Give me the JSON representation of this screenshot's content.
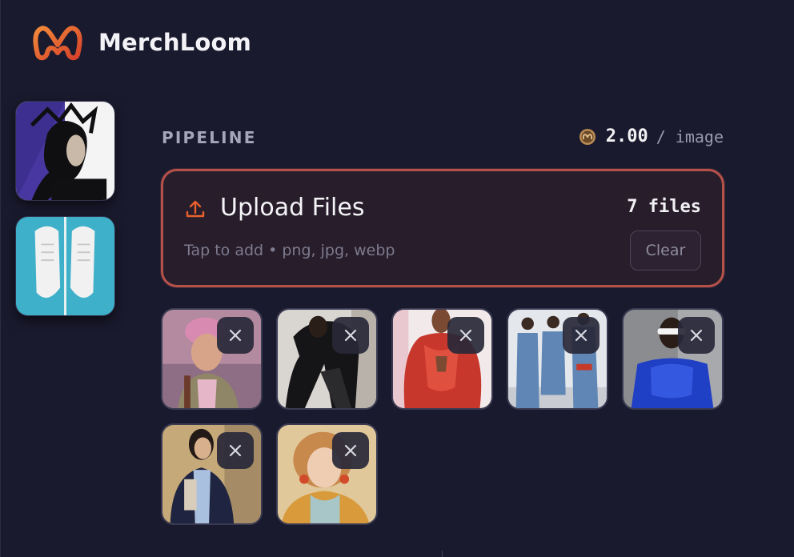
{
  "app": {
    "name": "MerchLoom",
    "logo_icon": "merchloom-m-logo",
    "accent": "#e8612c"
  },
  "sidebar": {
    "presets": [
      {
        "name": "preset-portrait-icon",
        "subject": "portrait"
      },
      {
        "name": "preset-sneakers-icon",
        "subject": "sneakers"
      }
    ]
  },
  "pipeline": {
    "label": "PIPELINE",
    "price_value": "2.00",
    "price_unit": "/ image",
    "coin_icon": "coin-icon"
  },
  "upload": {
    "title": "Upload Files",
    "count": "7 files",
    "hint": "Tap to add • png, jpg, webp",
    "clear_label": "Clear",
    "border_color": "#b4514a"
  },
  "files": [
    {
      "subject": "pink-hair-man"
    },
    {
      "subject": "black-outfit-pose"
    },
    {
      "subject": "red-jacket"
    },
    {
      "subject": "denim-group"
    },
    {
      "subject": "blue-dress"
    },
    {
      "subject": "blazer-woman"
    },
    {
      "subject": "curly-hair-woman"
    }
  ]
}
